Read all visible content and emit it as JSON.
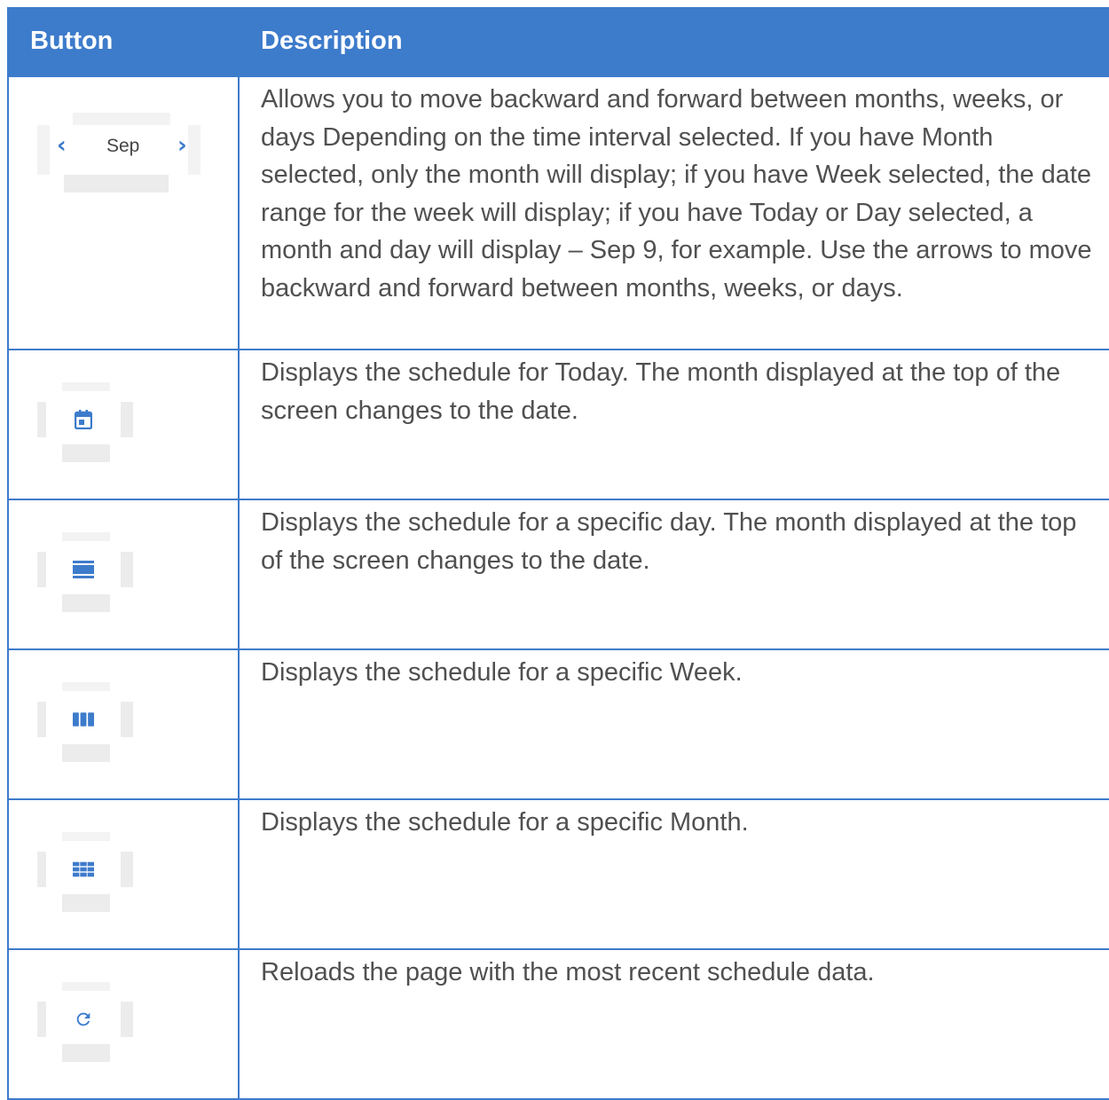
{
  "table": {
    "headers": {
      "button": "Button",
      "description": "Description"
    },
    "rows": [
      {
        "button_text": "Sep",
        "icon": "month-navigation-arrows",
        "description": "Allows you to move backward and forward between months, weeks, or days Depending on the time interval selected. If you have Month selected, only the month will display; if you have Week selected, the date range for the week will display; if you have Today or Day selected, a month and day will display – Sep 9, for example.  Use the arrows to move backward and forward between months, weeks, or days."
      },
      {
        "icon": "calendar-today-icon",
        "description": "Displays the schedule for Today.  The month displayed at the top of the screen changes to the date."
      },
      {
        "icon": "day-view-icon",
        "description": "Displays the schedule for a specific day. The month displayed at the top of the screen changes to the date."
      },
      {
        "icon": "week-view-icon",
        "description": "Displays the schedule for a specific Week."
      },
      {
        "icon": "month-view-icon",
        "description": "Displays the schedule for a specific Month."
      },
      {
        "icon": "refresh-icon",
        "description": "Reloads the page with the most recent schedule data."
      }
    ]
  },
  "colors": {
    "accent": "#3d7bcb",
    "text": "#505050",
    "header_text": "#ffffff"
  }
}
